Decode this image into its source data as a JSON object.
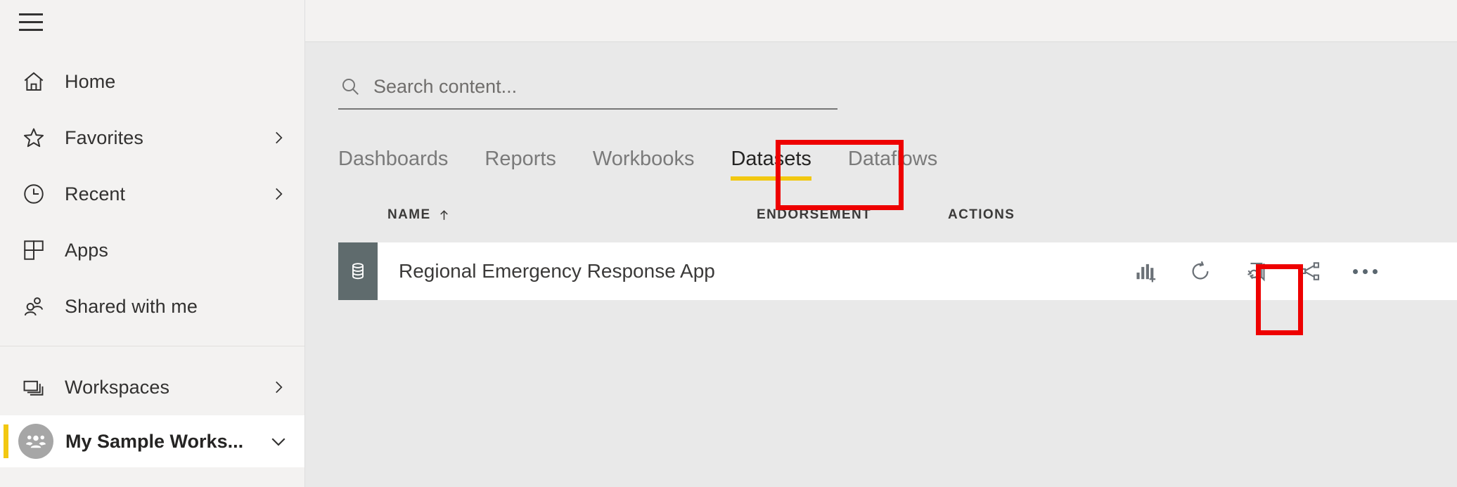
{
  "sidebar": {
    "hamburger_name": "navigation-menu",
    "items": [
      {
        "label": "Home",
        "icon": "home-icon",
        "chevron": false
      },
      {
        "label": "Favorites",
        "icon": "star-icon",
        "chevron": true
      },
      {
        "label": "Recent",
        "icon": "clock-icon",
        "chevron": true
      },
      {
        "label": "Apps",
        "icon": "apps-grid-icon",
        "chevron": false
      },
      {
        "label": "Shared with me",
        "icon": "people-icon",
        "chevron": false
      }
    ],
    "workspaces": {
      "label": "Workspaces",
      "icon": "layers-icon",
      "chevron": true
    },
    "selected_workspace": {
      "label": "My Sample Works...",
      "avatar_icon": "group-avatar-icon",
      "chevron": "chevron-down-icon",
      "accent_color": "#f2c811"
    }
  },
  "search": {
    "placeholder": "Search content...",
    "value": "",
    "icon": "search-icon"
  },
  "tabs": [
    {
      "label": "Dashboards",
      "active": false
    },
    {
      "label": "Reports",
      "active": false
    },
    {
      "label": "Workbooks",
      "active": false
    },
    {
      "label": "Datasets",
      "active": true
    },
    {
      "label": "Dataflows",
      "active": false
    }
  ],
  "table": {
    "headers": {
      "name": "NAME",
      "name_sort": "ascending",
      "endorsement": "ENDORSEMENT",
      "actions": "ACTIONS"
    },
    "rows": [
      {
        "name": "Regional Emergency Response App",
        "icon": "dataset-database-icon",
        "endorsement": "",
        "actions": [
          {
            "name": "create-report-icon",
            "title": "Create report"
          },
          {
            "name": "refresh-now-icon",
            "title": "Refresh now"
          },
          {
            "name": "schedule-refresh-icon",
            "title": "Schedule refresh"
          },
          {
            "name": "share-icon",
            "title": "Share"
          },
          {
            "name": "more-options-icon",
            "title": "More options"
          }
        ]
      }
    ]
  },
  "highlights": {
    "tab_box_color": "#ee0000",
    "action_box_color": "#ee0000"
  },
  "colors": {
    "accent_yellow": "#f2c811",
    "tile_slate": "#5f6b6d",
    "sidebar_bg": "#f3f2f1",
    "content_bg": "#e9e9e9",
    "row_bg": "#ffffff"
  }
}
